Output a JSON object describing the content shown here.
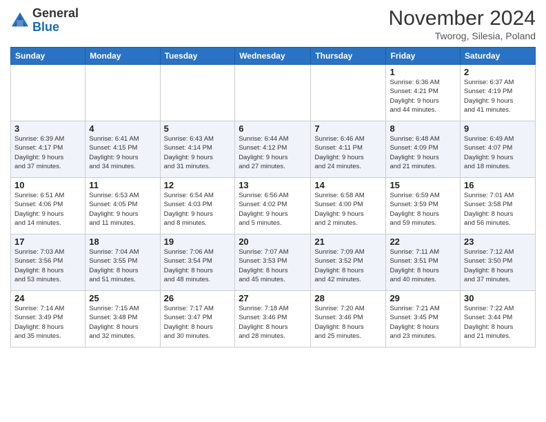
{
  "header": {
    "logo": {
      "general": "General",
      "blue": "Blue"
    },
    "title": "November 2024",
    "location": "Tworog, Silesia, Poland"
  },
  "days_of_week": [
    "Sunday",
    "Monday",
    "Tuesday",
    "Wednesday",
    "Thursday",
    "Friday",
    "Saturday"
  ],
  "weeks": [
    [
      {
        "day": "",
        "info": ""
      },
      {
        "day": "",
        "info": ""
      },
      {
        "day": "",
        "info": ""
      },
      {
        "day": "",
        "info": ""
      },
      {
        "day": "",
        "info": ""
      },
      {
        "day": "1",
        "info": "Sunrise: 6:36 AM\nSunset: 4:21 PM\nDaylight: 9 hours\nand 44 minutes."
      },
      {
        "day": "2",
        "info": "Sunrise: 6:37 AM\nSunset: 4:19 PM\nDaylight: 9 hours\nand 41 minutes."
      }
    ],
    [
      {
        "day": "3",
        "info": "Sunrise: 6:39 AM\nSunset: 4:17 PM\nDaylight: 9 hours\nand 37 minutes."
      },
      {
        "day": "4",
        "info": "Sunrise: 6:41 AM\nSunset: 4:15 PM\nDaylight: 9 hours\nand 34 minutes."
      },
      {
        "day": "5",
        "info": "Sunrise: 6:43 AM\nSunset: 4:14 PM\nDaylight: 9 hours\nand 31 minutes."
      },
      {
        "day": "6",
        "info": "Sunrise: 6:44 AM\nSunset: 4:12 PM\nDaylight: 9 hours\nand 27 minutes."
      },
      {
        "day": "7",
        "info": "Sunrise: 6:46 AM\nSunset: 4:11 PM\nDaylight: 9 hours\nand 24 minutes."
      },
      {
        "day": "8",
        "info": "Sunrise: 6:48 AM\nSunset: 4:09 PM\nDaylight: 9 hours\nand 21 minutes."
      },
      {
        "day": "9",
        "info": "Sunrise: 6:49 AM\nSunset: 4:07 PM\nDaylight: 9 hours\nand 18 minutes."
      }
    ],
    [
      {
        "day": "10",
        "info": "Sunrise: 6:51 AM\nSunset: 4:06 PM\nDaylight: 9 hours\nand 14 minutes."
      },
      {
        "day": "11",
        "info": "Sunrise: 6:53 AM\nSunset: 4:05 PM\nDaylight: 9 hours\nand 11 minutes."
      },
      {
        "day": "12",
        "info": "Sunrise: 6:54 AM\nSunset: 4:03 PM\nDaylight: 9 hours\nand 8 minutes."
      },
      {
        "day": "13",
        "info": "Sunrise: 6:56 AM\nSunset: 4:02 PM\nDaylight: 9 hours\nand 5 minutes."
      },
      {
        "day": "14",
        "info": "Sunrise: 6:58 AM\nSunset: 4:00 PM\nDaylight: 9 hours\nand 2 minutes."
      },
      {
        "day": "15",
        "info": "Sunrise: 6:59 AM\nSunset: 3:59 PM\nDaylight: 8 hours\nand 59 minutes."
      },
      {
        "day": "16",
        "info": "Sunrise: 7:01 AM\nSunset: 3:58 PM\nDaylight: 8 hours\nand 56 minutes."
      }
    ],
    [
      {
        "day": "17",
        "info": "Sunrise: 7:03 AM\nSunset: 3:56 PM\nDaylight: 8 hours\nand 53 minutes."
      },
      {
        "day": "18",
        "info": "Sunrise: 7:04 AM\nSunset: 3:55 PM\nDaylight: 8 hours\nand 51 minutes."
      },
      {
        "day": "19",
        "info": "Sunrise: 7:06 AM\nSunset: 3:54 PM\nDaylight: 8 hours\nand 48 minutes."
      },
      {
        "day": "20",
        "info": "Sunrise: 7:07 AM\nSunset: 3:53 PM\nDaylight: 8 hours\nand 45 minutes."
      },
      {
        "day": "21",
        "info": "Sunrise: 7:09 AM\nSunset: 3:52 PM\nDaylight: 8 hours\nand 42 minutes."
      },
      {
        "day": "22",
        "info": "Sunrise: 7:11 AM\nSunset: 3:51 PM\nDaylight: 8 hours\nand 40 minutes."
      },
      {
        "day": "23",
        "info": "Sunrise: 7:12 AM\nSunset: 3:50 PM\nDaylight: 8 hours\nand 37 minutes."
      }
    ],
    [
      {
        "day": "24",
        "info": "Sunrise: 7:14 AM\nSunset: 3:49 PM\nDaylight: 8 hours\nand 35 minutes."
      },
      {
        "day": "25",
        "info": "Sunrise: 7:15 AM\nSunset: 3:48 PM\nDaylight: 8 hours\nand 32 minutes."
      },
      {
        "day": "26",
        "info": "Sunrise: 7:17 AM\nSunset: 3:47 PM\nDaylight: 8 hours\nand 30 minutes."
      },
      {
        "day": "27",
        "info": "Sunrise: 7:18 AM\nSunset: 3:46 PM\nDaylight: 8 hours\nand 28 minutes."
      },
      {
        "day": "28",
        "info": "Sunrise: 7:20 AM\nSunset: 3:46 PM\nDaylight: 8 hours\nand 25 minutes."
      },
      {
        "day": "29",
        "info": "Sunrise: 7:21 AM\nSunset: 3:45 PM\nDaylight: 8 hours\nand 23 minutes."
      },
      {
        "day": "30",
        "info": "Sunrise: 7:22 AM\nSunset: 3:44 PM\nDaylight: 8 hours\nand 21 minutes."
      }
    ]
  ]
}
